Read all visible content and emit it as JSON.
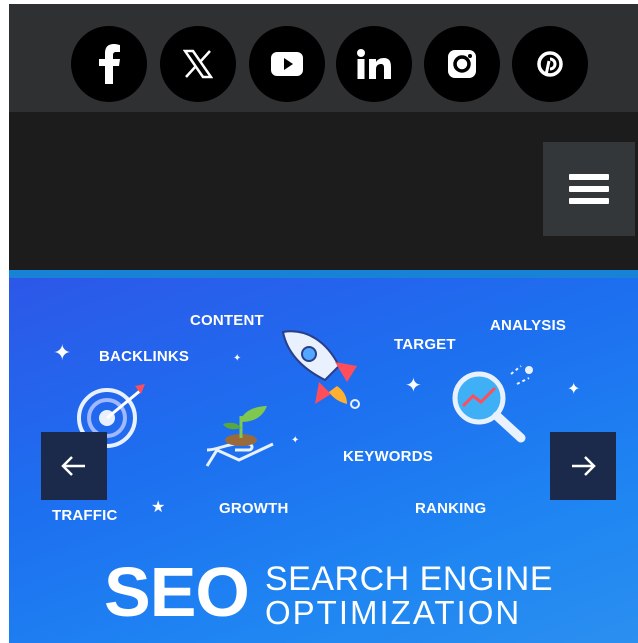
{
  "social": {
    "items": [
      {
        "name": "facebook",
        "icon": "facebook-icon"
      },
      {
        "name": "x",
        "icon": "x-icon"
      },
      {
        "name": "youtube",
        "icon": "youtube-icon"
      },
      {
        "name": "linkedin",
        "icon": "linkedin-icon"
      },
      {
        "name": "instagram",
        "icon": "instagram-icon"
      },
      {
        "name": "pinterest",
        "icon": "pinterest-icon"
      }
    ]
  },
  "nav": {
    "menu_icon": "hamburger-menu-icon"
  },
  "hero": {
    "labels": {
      "content": "CONTENT",
      "backlinks": "BACKLINKS",
      "target": "TARGET",
      "analysis": "ANALYSIS",
      "keywords": "KEYWORDS",
      "traffic": "TRAFFIC",
      "growth": "GROWTH",
      "ranking": "RANKING"
    },
    "title_big": "SEO",
    "title_line1": "SEARCH ENGINE",
    "title_line2": "OPTIMIZATION",
    "prev_icon": "arrow-left-icon",
    "next_icon": "arrow-right-icon"
  },
  "colors": {
    "social_bar": "#2f3032",
    "nav_bar": "#1c1c1c",
    "accent": "#1883d6",
    "hero_blue": "#1f6ff0",
    "slider_arrow_bg": "#1b2a4a"
  }
}
